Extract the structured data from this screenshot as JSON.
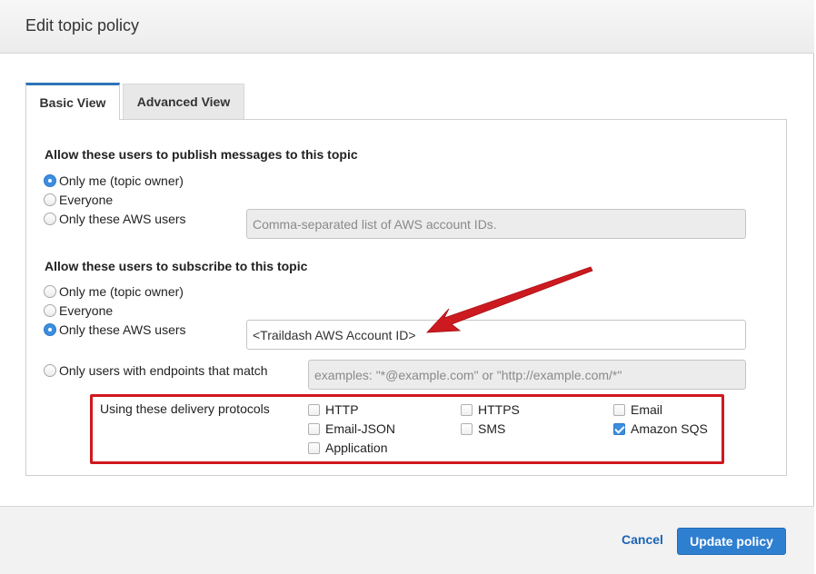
{
  "dialog": {
    "title": "Edit topic policy"
  },
  "tabs": [
    {
      "label": "Basic View",
      "active": true
    },
    {
      "label": "Advanced View",
      "active": false
    }
  ],
  "publish": {
    "title": "Allow these users to publish messages to this topic",
    "options": [
      "Only me (topic owner)",
      "Everyone",
      "Only these AWS users"
    ],
    "selected": "Only me (topic owner)",
    "aws_users_placeholder": "Comma-separated list of AWS account IDs."
  },
  "subscribe": {
    "title": "Allow these users to subscribe to this topic",
    "options": [
      "Only me (topic owner)",
      "Everyone",
      "Only these AWS users",
      "Only users with endpoints that match"
    ],
    "selected": "Only these AWS users",
    "aws_users_value": "<Traildash AWS Account ID>",
    "endpoints_placeholder": "examples: \"*@example.com\" or \"http://example.com/*\"",
    "protocols_label": "Using these delivery protocols",
    "protocols": [
      {
        "label": "HTTP",
        "checked": false
      },
      {
        "label": "HTTPS",
        "checked": false
      },
      {
        "label": "Email",
        "checked": false
      },
      {
        "label": "Email-JSON",
        "checked": false
      },
      {
        "label": "SMS",
        "checked": false
      },
      {
        "label": "Amazon SQS",
        "checked": true
      },
      {
        "label": "Application",
        "checked": false
      }
    ]
  },
  "footer": {
    "cancel_label": "Cancel",
    "update_label": "Update policy"
  },
  "colors": {
    "accent": "#2f7fd1",
    "annotation_red": "#d0181f"
  }
}
